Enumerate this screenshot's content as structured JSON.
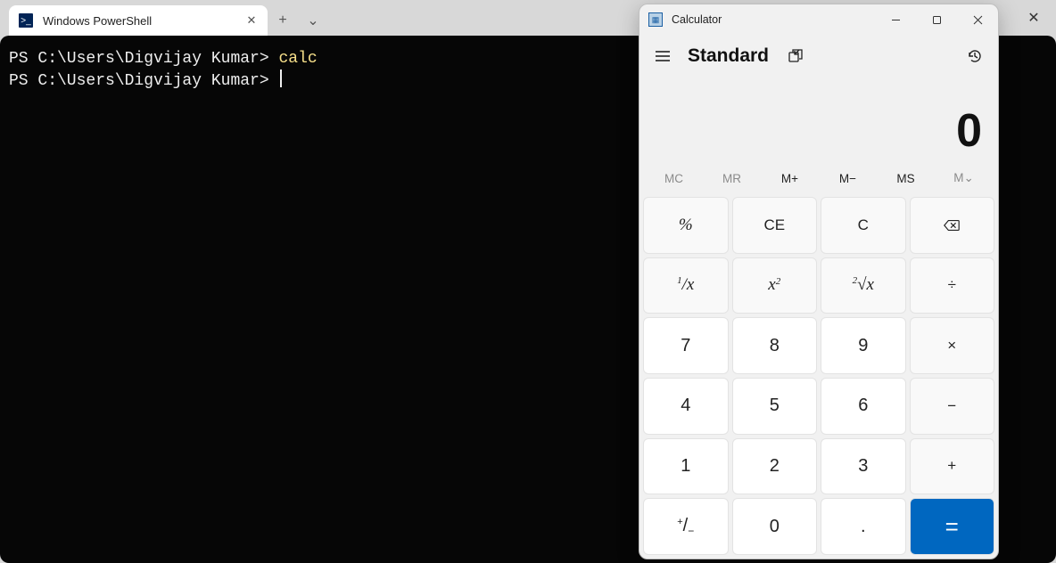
{
  "terminal": {
    "tab_title": "Windows PowerShell",
    "new_tab_glyph": "+",
    "dropdown_glyph": "⌄",
    "close_glyph": "✕",
    "prompt": "PS C:\\Users\\Digvijay Kumar>",
    "lines": [
      {
        "command": "calc"
      }
    ]
  },
  "calc": {
    "app_title": "Calculator",
    "mode": "Standard",
    "display": "0",
    "memory": {
      "mc": "MC",
      "mr": "MR",
      "mplus": "M+",
      "mminus": "M−",
      "ms": "MS",
      "mlist": "M⌄"
    },
    "keys": {
      "pct": "%",
      "ce": "CE",
      "c": "C",
      "recip": "¹/ₓ",
      "sq": "x²",
      "root": "²√x",
      "div": "÷",
      "k7": "7",
      "k8": "8",
      "k9": "9",
      "mul": "×",
      "k4": "4",
      "k5": "5",
      "k6": "6",
      "sub": "−",
      "k1": "1",
      "k2": "2",
      "k3": "3",
      "add": "+",
      "neg": "+/₋",
      "k0": "0",
      "dot": ".",
      "eq": "="
    }
  }
}
